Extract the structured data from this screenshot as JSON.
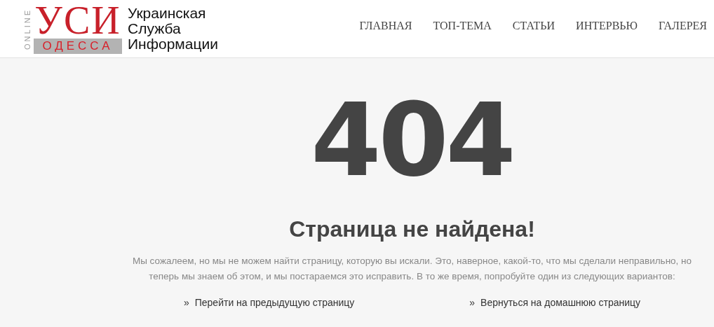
{
  "logo": {
    "side_text": "ONLINE",
    "mark": "УСИ",
    "city": "ОДЕССА",
    "name_lines": [
      "Украинская",
      "Служба",
      "Информации"
    ]
  },
  "nav": [
    {
      "label": "ГЛАВНАЯ"
    },
    {
      "label": "ТОП-ТЕМА"
    },
    {
      "label": "СТАТЬИ"
    },
    {
      "label": "ИНТЕРВЬЮ"
    },
    {
      "label": "ГАЛЕРЕЯ"
    }
  ],
  "error": {
    "code": "404",
    "title": "Страница не найдена!",
    "message": "Мы сожалеем, но мы не можем найти страницу, которую вы искали. Это, наверное, какой-то, что мы сделали неправильно, но теперь мы знаем об этом, и мы постараемся это исправить. В то же время, попробуйте один из следующих вариантов:"
  },
  "links": [
    {
      "marker": "»",
      "label": "Перейти на предыдущую страницу"
    },
    {
      "marker": "»",
      "label": "Вернуться на домашнюю страницу"
    }
  ]
}
